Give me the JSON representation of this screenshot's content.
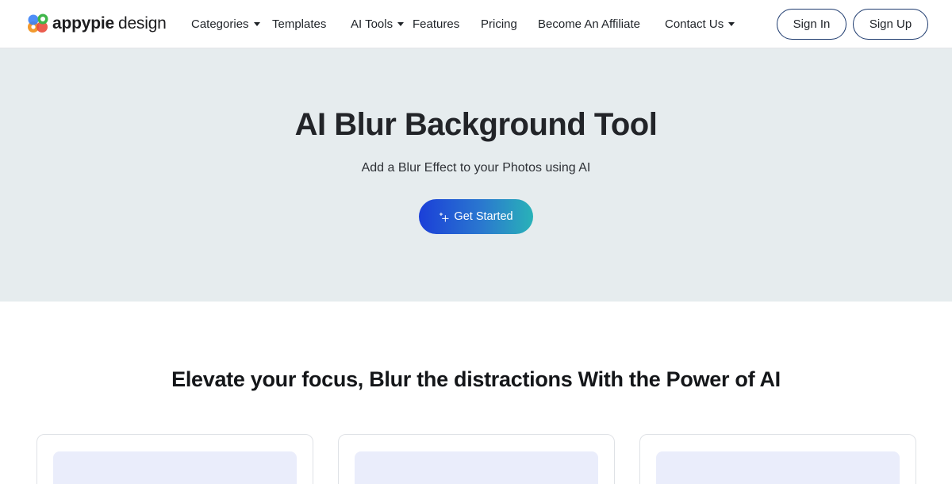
{
  "brand": {
    "name_bold": "appypie",
    "name_light": "design",
    "colors": {
      "green": "#3fb64a",
      "red": "#e94b3c",
      "orange": "#f29a2e",
      "blue": "#3b82f6"
    }
  },
  "nav": {
    "items": [
      {
        "label": "Categories",
        "has_dropdown": true
      },
      {
        "label": "Templates",
        "has_dropdown": false
      },
      {
        "label": "AI Tools",
        "has_dropdown": true
      },
      {
        "label": "Features",
        "has_dropdown": false
      },
      {
        "label": "Pricing",
        "has_dropdown": false
      },
      {
        "label": "Become An Affiliate",
        "has_dropdown": false
      },
      {
        "label": "Contact Us",
        "has_dropdown": true
      }
    ],
    "sign_in": "Sign In",
    "sign_up": "Sign Up"
  },
  "hero": {
    "title": "AI Blur Background Tool",
    "subtitle": "Add a Blur Effect to your Photos using AI",
    "cta_label": "Get Started",
    "cta_icon": "sparkle-icon",
    "background": "#e6ecee"
  },
  "section": {
    "title": "Elevate your focus, Blur the distractions With the Power of AI",
    "cards": [
      {},
      {},
      {}
    ]
  }
}
